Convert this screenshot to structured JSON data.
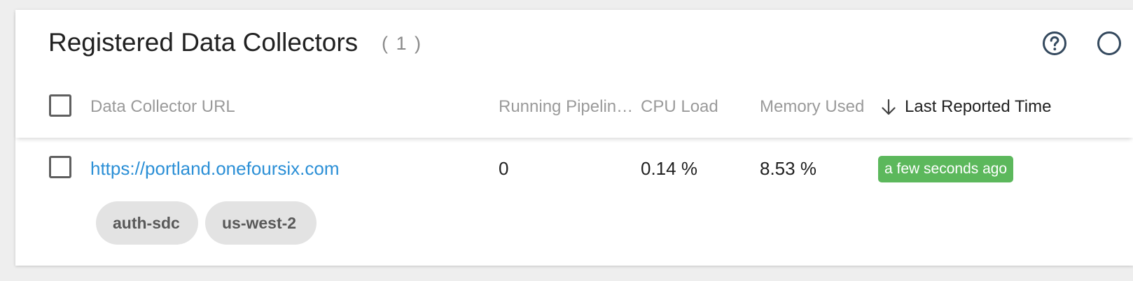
{
  "header": {
    "title": "Registered Data Collectors",
    "count": "( 1 )"
  },
  "columns": {
    "url": "Data Collector URL",
    "running_pipelines": "Running Pipelin…",
    "cpu_load": "CPU Load",
    "memory_used": "Memory Used",
    "last_reported_time": "Last Reported Time"
  },
  "rows": [
    {
      "url": "https://portland.onefoursix.com",
      "running_pipelines": "0",
      "cpu_load": "0.14 %",
      "memory_used": "8.53 %",
      "last_reported": "a few seconds ago",
      "labels": [
        "auth-sdc",
        "us-west-2"
      ]
    }
  ],
  "icons": {
    "help": "help-circle-icon",
    "sort": "arrow-down-icon",
    "partial": "toolbar-icon"
  },
  "colors": {
    "link": "#2b8fd6",
    "status_badge": "#5cb85c",
    "chip_bg": "#e3e3e3",
    "icon": "#34495e"
  }
}
